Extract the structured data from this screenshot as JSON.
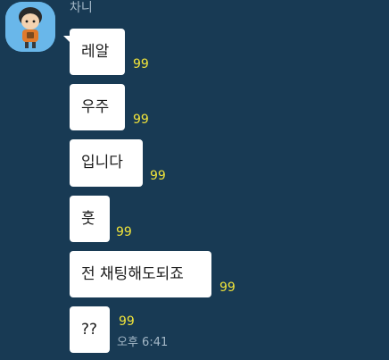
{
  "chat": {
    "sender": {
      "name": "차니",
      "avatar_icon": "cartoon-character-avatar-icon",
      "avatar_bg": "#69b7ea"
    },
    "messages": [
      {
        "text": "레알",
        "unread": "99"
      },
      {
        "text": "우주",
        "unread": "99"
      },
      {
        "text": "입니다",
        "unread": "99"
      },
      {
        "text": "훗",
        "unread": "99"
      },
      {
        "text": "전 채팅해도되죠",
        "unread": "99"
      },
      {
        "text": "??",
        "unread": "99",
        "time": "오후 6:41"
      }
    ]
  },
  "theme": {
    "background": "#183a54",
    "bubble": "#ffffff",
    "unread_color": "#f1e43a",
    "meta_color": "#a4b8c7"
  }
}
